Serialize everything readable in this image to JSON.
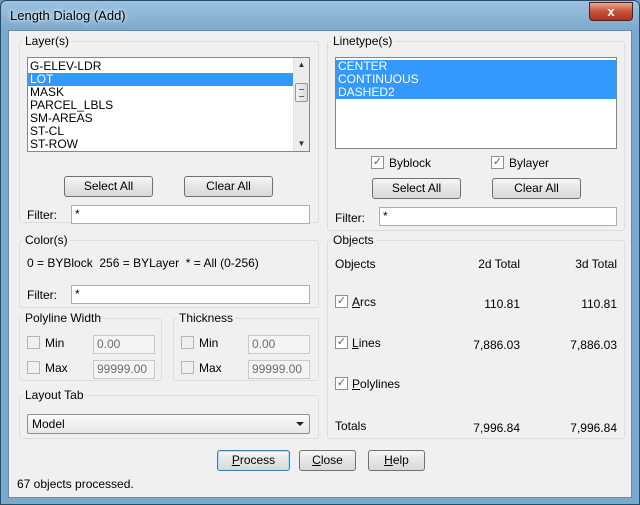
{
  "window": {
    "title": "Length Dialog (Add)",
    "close_glyph": "x"
  },
  "layers": {
    "label": "Layer(s)",
    "items": [
      {
        "label": "G-ELEV-LDR",
        "selected": false
      },
      {
        "label": "LOT",
        "selected": true
      },
      {
        "label": "MASK",
        "selected": false
      },
      {
        "label": "PARCEL_LBLS",
        "selected": false
      },
      {
        "label": "SM-AREAS",
        "selected": false
      },
      {
        "label": "ST-CL",
        "selected": false
      },
      {
        "label": "ST-ROW",
        "selected": false
      }
    ],
    "select_all_label": "Select All",
    "clear_all_label": "Clear All",
    "filter_label": "Filter:",
    "filter_value": "*"
  },
  "linetypes": {
    "label": "Linetype(s)",
    "items": [
      {
        "label": "CENTER",
        "selected": true
      },
      {
        "label": "CONTINUOUS",
        "selected": true
      },
      {
        "label": "DASHED2",
        "selected": true
      }
    ],
    "byblock_label": "Byblock",
    "byblock_checked": true,
    "bylayer_label": "Bylayer",
    "bylayer_checked": true,
    "select_all_label": "Select All",
    "clear_all_label": "Clear All",
    "filter_label": "Filter:",
    "filter_value": "*"
  },
  "colors": {
    "label": "Color(s)",
    "hint": "0 = BYBlock  256 = BYLayer  * = All (0-256)",
    "filter_label": "Filter:",
    "filter_value": "*"
  },
  "polyline_width": {
    "label": "Polyline Width",
    "min_label": "Min",
    "min_value": "0.00",
    "max_label": "Max",
    "max_value": "99999.00"
  },
  "thickness": {
    "label": "Thickness",
    "min_label": "Min",
    "min_value": "0.00",
    "max_label": "Max",
    "max_value": "99999.00"
  },
  "layout_tab": {
    "label": "Layout Tab",
    "selected": "Model"
  },
  "objects": {
    "label": "Objects",
    "col_objects": "Objects",
    "col_2d": "2d Total",
    "col_3d": "3d Total",
    "rows": [
      {
        "label_accel": "A",
        "label_rest": "rcs",
        "checked": true,
        "total_2d": "110.81",
        "total_3d": "110.81"
      },
      {
        "label_accel": "L",
        "label_rest": "ines",
        "checked": true,
        "total_2d": "7,886.03",
        "total_3d": "7,886.03"
      },
      {
        "label_accel": "P",
        "label_rest": "olylines",
        "checked": true,
        "total_2d": "",
        "total_3d": ""
      }
    ],
    "totals_label": "Totals",
    "totals_2d": "7,996.84",
    "totals_3d": "7,996.84"
  },
  "buttons": {
    "process_accel": "P",
    "process_rest": "rocess",
    "close_accel": "C",
    "close_rest": "lose",
    "help_accel": "H",
    "help_rest": "elp"
  },
  "status": "67 objects processed."
}
